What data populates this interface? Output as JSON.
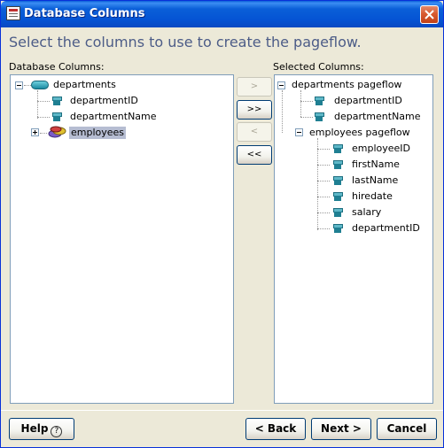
{
  "window": {
    "title": "Database Columns"
  },
  "heading": "Select the columns to use to create the pageflow.",
  "left_panel": {
    "label": "Database Columns:",
    "root": {
      "label": "departments",
      "icon": "database-table-icon"
    },
    "children": [
      {
        "label": "departmentID",
        "icon": "column-icon"
      },
      {
        "label": "departmentName",
        "icon": "column-icon"
      }
    ],
    "collapsed": {
      "label": "employees",
      "icon": "table-group-icon"
    }
  },
  "right_panel": {
    "label": "Selected Columns:",
    "groups": [
      {
        "label": "departments pageflow",
        "items": [
          "departmentID",
          "departmentName"
        ]
      },
      {
        "label": "employees pageflow",
        "items": [
          "employeeID",
          "firstName",
          "lastName",
          "hiredate",
          "salary",
          "departmentID"
        ]
      }
    ]
  },
  "transfer_buttons": {
    "add": ">",
    "add_all": ">>",
    "remove": "<",
    "remove_all": "<<"
  },
  "footer": {
    "help": "Help",
    "back": "< Back",
    "next": "Next >",
    "cancel": "Cancel"
  },
  "colors": {
    "title_bar": "#0a5fd8",
    "heading": "#4c5c87",
    "selection": "#b6bdd2",
    "dialog_bg": "#ece9d8"
  }
}
